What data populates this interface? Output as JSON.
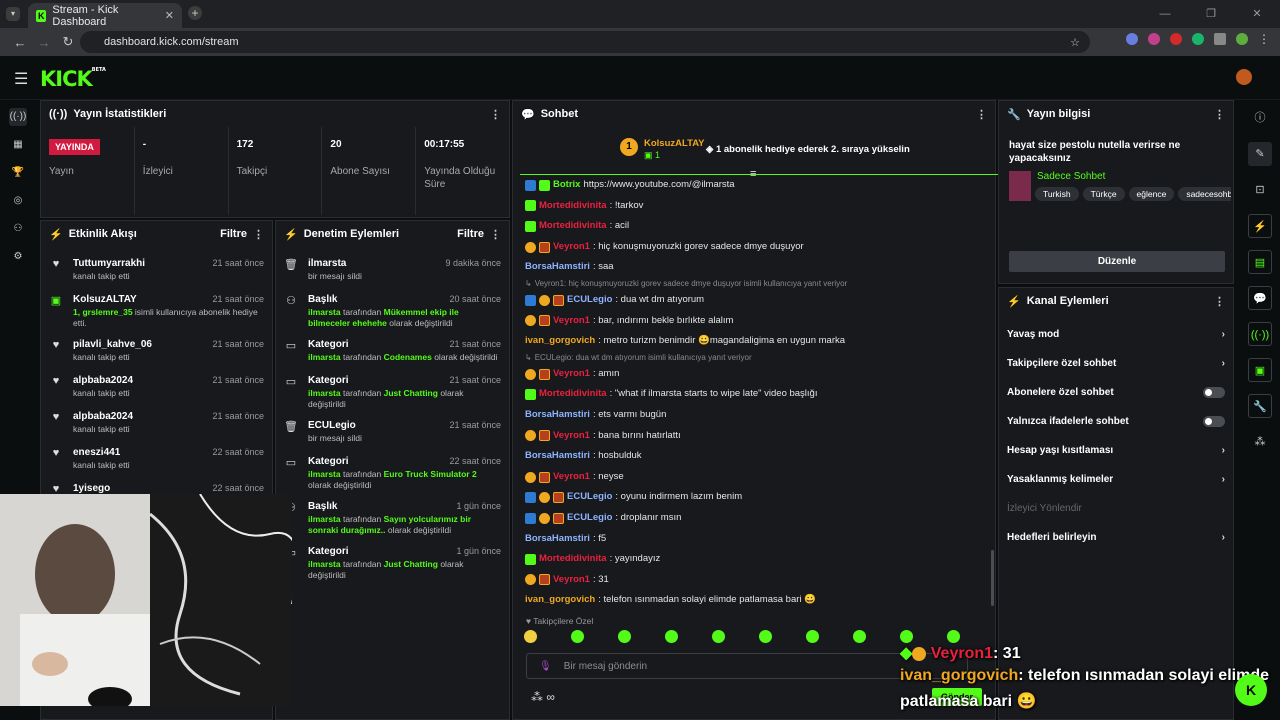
{
  "browser": {
    "tab_title": "Stream - Kick Dashboard",
    "url": "dashboard.kick.com/stream"
  },
  "brand": {
    "logo": "KICK",
    "beta": "BETA"
  },
  "stats_panel": {
    "title": "Yayın İstatistikleri",
    "live_badge": "YAYINDA",
    "items": [
      {
        "value": "",
        "label": "Yayın"
      },
      {
        "value": "-",
        "label": "İzleyici"
      },
      {
        "value": "172",
        "label": "Takipçi"
      },
      {
        "value": "20",
        "label": "Abone Sayısı"
      },
      {
        "value": "00:17:55",
        "label": "Yayında Olduğu Süre"
      }
    ]
  },
  "activity": {
    "title": "Etkinlik Akışı",
    "filter": "Filtre",
    "items": [
      {
        "name": "Tuttumyarrakhi",
        "time": "21 saat önce",
        "desc": "kanalı takip etti",
        "icon": "heart-icon"
      },
      {
        "name": "KolsuzALTAY",
        "time": "21 saat önce",
        "desc_green": "1, grslemre_35",
        "desc": "isimli kullanıcıya abonelik hediye etti.",
        "icon": "gift-icon"
      },
      {
        "name": "pilavli_kahve_06",
        "time": "21 saat önce",
        "desc": "kanalı takip etti",
        "icon": "heart-icon"
      },
      {
        "name": "alpbaba2024",
        "time": "21 saat önce",
        "desc": "kanalı takip etti",
        "icon": "heart-icon"
      },
      {
        "name": "alpbaba2024",
        "time": "21 saat önce",
        "desc": "kanalı takip etti",
        "icon": "heart-icon"
      },
      {
        "name": "eneszi441",
        "time": "22 saat önce",
        "desc": "kanalı takip etti",
        "icon": "heart-icon"
      },
      {
        "name": "1yisego",
        "time": "22 saat önce",
        "desc": "",
        "icon": "heart-icon"
      }
    ]
  },
  "moderation": {
    "title": "Denetim Eylemleri",
    "filter": "Filtre",
    "items": [
      {
        "name": "ilmarsta",
        "time": "9 dakika önce",
        "actor": "",
        "mid": "bir mesajı sildi",
        "value": "",
        "tail": ""
      },
      {
        "name": "Başlık",
        "time": "20 saat önce",
        "actor": "ilmarsta",
        "mid": "tarafından",
        "value": "Mükemmel ekip ile bilmeceler ehehehe",
        "tail": "olarak değiştirildi"
      },
      {
        "name": "Kategori",
        "time": "21 saat önce",
        "actor": "ilmarsta",
        "mid": "tarafından",
        "value": "Codenames",
        "tail": "olarak değiştirildi"
      },
      {
        "name": "Kategori",
        "time": "21 saat önce",
        "actor": "ilmarsta",
        "mid": "tarafından",
        "value": "Just Chatting",
        "tail": "olarak değiştirildi"
      },
      {
        "name": "ECULegio",
        "time": "21 saat önce",
        "actor": "",
        "mid": "bir mesajı sildi",
        "value": "",
        "tail": ""
      },
      {
        "name": "Kategori",
        "time": "22 saat önce",
        "actor": "ilmarsta",
        "mid": "tarafından",
        "value": "Euro Truck Simulator 2",
        "tail": "olarak değiştirildi"
      },
      {
        "name": "Başlık",
        "time": "1 gün önce",
        "actor": "ilmarsta",
        "mid": "tarafından",
        "value": "Sayın yolcularımız bir sonraki durağımız..",
        "tail": "olarak değiştirildi"
      },
      {
        "name": "Kategori",
        "time": "1 gün önce",
        "actor": "ilmarsta",
        "mid": "tarafından",
        "value": "Just Chatting",
        "tail": "olarak değiştirildi"
      }
    ]
  },
  "chat": {
    "title": "Sohbet",
    "pinned_user": "KolsuzALTAY",
    "pinned_count": "1",
    "pinned_text": "1 abonelik hediye ederek 2. sıraya yükselin",
    "messages": [
      {
        "user": "Botrix",
        "color": "#53fc18",
        "text": "https://www.youtube.com/@ilmarsta",
        "badges": "bg"
      },
      {
        "user": "Mortedidivinita",
        "color": "#e8213f",
        "text": ": !tarkov",
        "badges": "g"
      },
      {
        "user": "Mortedidivinita",
        "color": "#e8213f",
        "text": ": acil",
        "badges": "g"
      },
      {
        "user": "Veyron1",
        "color": "#e8213f",
        "text": ": hiç konuşmuyoruzki gorev sadece dmye duşuyor",
        "badges": "os"
      },
      {
        "user": "BorsaHamstiri",
        "color": "#8cb4ff",
        "text": ": saa",
        "badges": ""
      },
      {
        "reply": "Veyron1: hiç konuşmuyoruzki gorev sadece dmye duşuyor isimli kullanıcıya yanıt veriyor"
      },
      {
        "user": "ECULegio",
        "color": "#8cb4ff",
        "text": ": dua wt dm atıyorum",
        "badges": "bos"
      },
      {
        "user": "Veyron1",
        "color": "#e8213f",
        "text": ": bar, ındırımı bekle bırlıkte alalım",
        "badges": "os"
      },
      {
        "user": "ivan_gorgovich",
        "color": "#f0a820",
        "text": ": metro turizm benimdir 😀magandaligima en uygun marka",
        "badges": ""
      },
      {
        "reply": "ECULegio: dua wt dm atıyorum isimli kullanıcıya yanıt veriyor"
      },
      {
        "user": "Veyron1",
        "color": "#e8213f",
        "text": ": amın",
        "badges": "os"
      },
      {
        "user": "Mortedidivinita",
        "color": "#e8213f",
        "text": ": \"what if ilmarsta starts to wipe late\" video başlığı",
        "badges": "g"
      },
      {
        "user": "BorsaHamstiri",
        "color": "#8cb4ff",
        "text": ": ets varmı bugün",
        "badges": ""
      },
      {
        "user": "Veyron1",
        "color": "#e8213f",
        "text": ": bana bırını hatırlattı",
        "badges": "os"
      },
      {
        "user": "BorsaHamstiri",
        "color": "#8cb4ff",
        "text": ": hosbulduk",
        "badges": ""
      },
      {
        "user": "Veyron1",
        "color": "#e8213f",
        "text": ": neyse",
        "badges": "os"
      },
      {
        "user": "ECULegio",
        "color": "#8cb4ff",
        "text": ": oyunu indirmem lazım benim",
        "badges": "bos"
      },
      {
        "user": "ECULegio",
        "color": "#8cb4ff",
        "text": ": droplanır msın",
        "badges": "bos"
      },
      {
        "user": "BorsaHamstiri",
        "color": "#8cb4ff",
        "text": ": f5",
        "badges": ""
      },
      {
        "user": "Mortedidivinita",
        "color": "#e8213f",
        "text": ": yayındayız",
        "badges": "g"
      },
      {
        "user": "Veyron1",
        "color": "#e8213f",
        "text": ": 31",
        "badges": "os"
      },
      {
        "user": "ivan_gorgovich",
        "color": "#f0a820",
        "text": ": telefon ısınmadan solayi elimde patlamasa bari 😀",
        "badges": ""
      }
    ],
    "followers_only": "Takipçilere Özel",
    "input_placeholder": "Bir mesaj gönderin",
    "send": "Gönder"
  },
  "stream_info": {
    "title": "Yayın bilgisi",
    "stream_title": "hayat size pestolu nutella verirse ne yapacaksınız",
    "category": "Sadece Sohbet",
    "tags": [
      "Turkish",
      "Türkçe",
      "eğlence",
      "sadecesohbe"
    ],
    "edit": "Düzenle"
  },
  "channel_actions": {
    "title": "Kanal Eylemleri",
    "items": [
      {
        "label": "Yavaş mod",
        "type": "chevron"
      },
      {
        "label": "Takipçilere özel sohbet",
        "type": "chevron"
      },
      {
        "label": "Abonelere özel sohbet",
        "type": "toggle"
      },
      {
        "label": "Yalnızca ifadelerle sohbet",
        "type": "toggle"
      },
      {
        "label": "Hesap yaşı kısıtlaması",
        "type": "chevron"
      },
      {
        "label": "Yasaklanmış kelimeler",
        "type": "chevron"
      },
      {
        "label": "İzleyici Yönlendir",
        "type": "disabled"
      },
      {
        "label": "Hedefleri belirleyin",
        "type": "chevron"
      }
    ]
  },
  "overlay": {
    "line1_user": "Veyron1",
    "line1_text": ": 31",
    "line2_user": "ivan_gorgovich",
    "line2_text": ": telefon ısınmadan solayi elimde",
    "line3_text": "patlamasa bari 😀"
  }
}
